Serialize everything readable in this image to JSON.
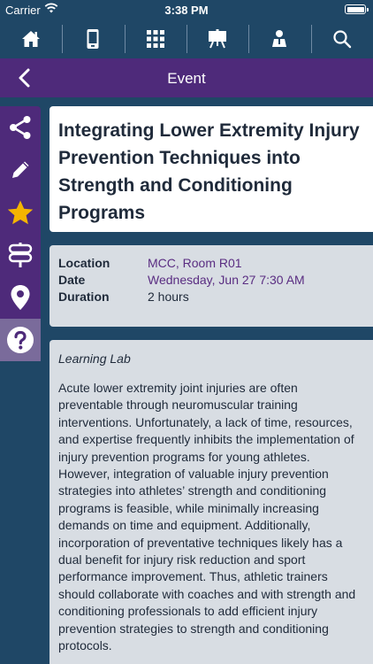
{
  "status_bar": {
    "carrier": "Carrier",
    "time": "3:38 PM"
  },
  "nav": {
    "items": [
      {
        "name": "home-icon"
      },
      {
        "name": "phone-icon"
      },
      {
        "name": "grid-icon"
      },
      {
        "name": "presentation-icon"
      },
      {
        "name": "exhibitor-icon"
      },
      {
        "name": "search-icon"
      }
    ]
  },
  "header": {
    "title": "Event"
  },
  "sidebar": {
    "items": [
      {
        "name": "share-icon"
      },
      {
        "name": "pencil-icon"
      },
      {
        "name": "star-icon"
      },
      {
        "name": "signpost-icon"
      },
      {
        "name": "map-pin-icon"
      },
      {
        "name": "question-icon",
        "active": true
      }
    ]
  },
  "event": {
    "title": "Integrating Lower Extremity Injury Prevention Techniques into Strength and Conditioning Programs",
    "location_label": "Location",
    "location_value": "MCC, Room R01",
    "date_label": "Date",
    "date_value": "Wednesday, Jun 27 7:30 AM",
    "duration_label": "Duration",
    "duration_value": "2 hours",
    "session_type": "Learning Lab",
    "description": "Acute lower extremity joint injuries are often preventable through neuromuscular training interventions. Unfortunately, a lack of time, resources, and expertise frequently inhibits the implementation of injury prevention programs for young athletes. However, integration of valuable injury prevention strategies into athletes’ strength and conditioning programs is feasible, while minimally increasing demands on time and equipment. Additionally, incorporation of preventative techniques likely has a dual benefit for injury risk reduction and sport performance improvement. Thus, athletic trainers should collaborate with coaches and with strength and conditioning professionals to add efficient injury prevention strategies to strength and conditioning protocols."
  },
  "colors": {
    "nav_bg": "#1f4766",
    "purple": "#4e2a7a",
    "link_purple": "#5a2d82",
    "card_bg": "#d8dde3",
    "star": "#f4b400"
  }
}
